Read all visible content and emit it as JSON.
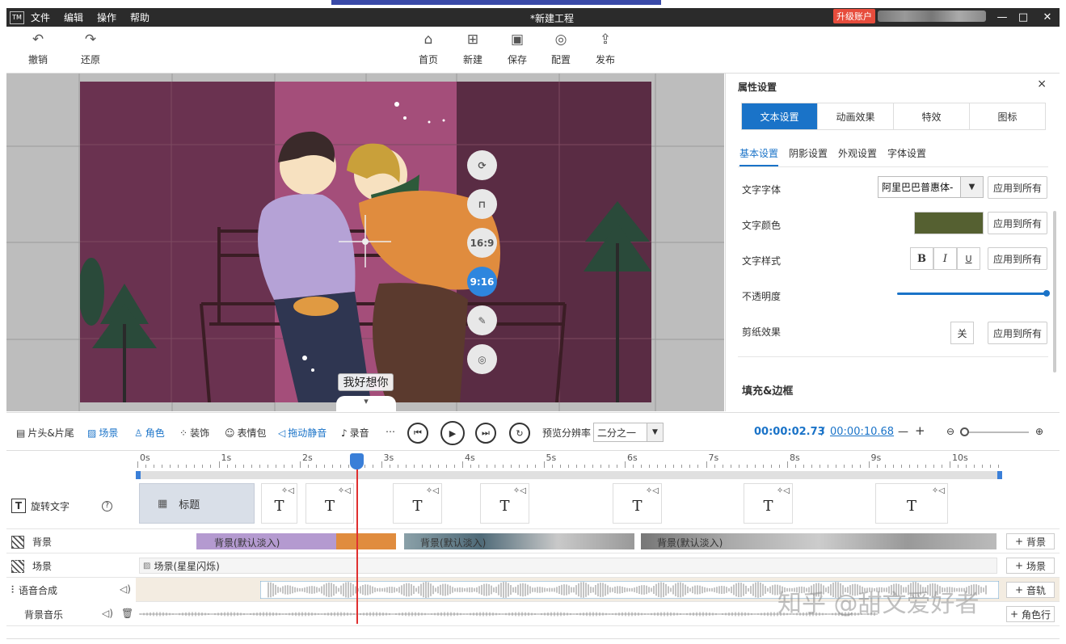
{
  "titlebar": {
    "logo": "TM",
    "menu": [
      "文件",
      "编辑",
      "操作",
      "帮助"
    ],
    "title": "*新建工程",
    "upgrade": "升级账户",
    "win": [
      "—",
      "□",
      "✕"
    ]
  },
  "toolbar": {
    "undo": "撤销",
    "redo": "还原",
    "home": "首页",
    "new": "新建",
    "save": "保存",
    "config": "配置",
    "publish": "发布"
  },
  "canvas": {
    "subtitle": "我好想你",
    "controls": [
      "16:9",
      "9:16"
    ]
  },
  "panel": {
    "title": "属性设置",
    "close": "×",
    "tabs": [
      "文本设置",
      "动画效果",
      "特效",
      "图标"
    ],
    "subtabs": [
      "基本设置",
      "阴影设置",
      "外观设置",
      "字体设置"
    ],
    "font_label": "文字字体",
    "font_value": "阿里巴巴普惠体-",
    "color_label": "文字颜色",
    "color_value": "#556031",
    "style_label": "文字样式",
    "style_buttons": [
      "B",
      "I",
      "U"
    ],
    "opacity_label": "不透明度",
    "opacity_value": 1.0,
    "paper_label": "剪纸效果",
    "paper_value": "关",
    "apply": "应用到所有",
    "section": "填充&边框"
  },
  "controlbar": {
    "head_tail": "片头&片尾",
    "scene": "场景",
    "role": "角色",
    "decor": "装饰",
    "emoji": "表情包",
    "mute": "拖动静音",
    "record": "录音",
    "resolution_label": "预览分辨率",
    "resolution_value": "二分之一",
    "time_current": "00:00:02.73",
    "time_sep": "/",
    "time_total": "00:00:10.68",
    "minus": "—",
    "plus": "+"
  },
  "ruler": {
    "ticks": [
      "0s",
      "1s",
      "2s",
      "3s",
      "4s",
      "5s",
      "6s",
      "7s",
      "8s",
      "9s",
      "10s"
    ]
  },
  "tracks": {
    "text": {
      "label": "旋转文字",
      "title_clip": "标题",
      "clip_glyph": "T"
    },
    "background": {
      "label": "背景",
      "clips": [
        "背景(默认淡入)",
        "背景(默认淡入)",
        "背景(默认淡入)"
      ],
      "btn": "背景"
    },
    "scene": {
      "label": "场景",
      "clip": "场景(星星闪烁)",
      "btn": "场景"
    },
    "tts": {
      "label": "语音合成",
      "btn": "音轨"
    },
    "bgm": {
      "label": "背景音乐",
      "btn": "角色行"
    }
  },
  "watermark": "知乎 @甜文爱好者"
}
